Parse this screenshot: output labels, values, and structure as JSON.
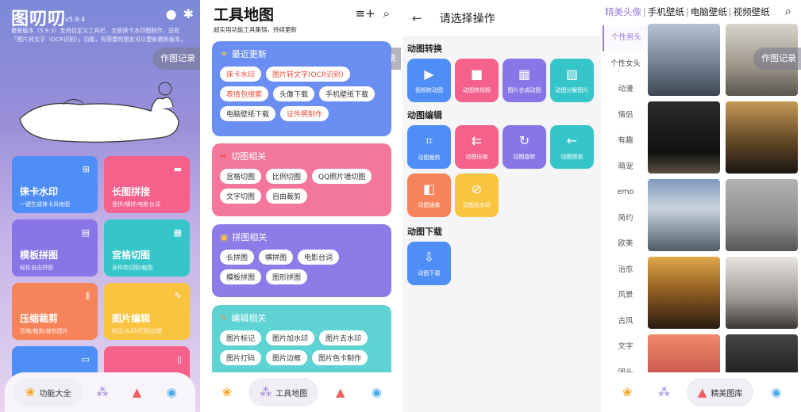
{
  "record_label": "作图记录",
  "panel1": {
    "app_title": "图叨叨",
    "version": "v5.9.4",
    "description": "最新版本（5.9.3）支持自定义工具栏，全新徕卡水印图制作，还有「图片转文字（OCR识别）」功能，有需要的朋友可以更新最新版本。",
    "tiles": [
      {
        "title": "徕卡水印",
        "sub": "一键生成徕卡风格图",
        "color": "#4f8ef7"
      },
      {
        "title": "长图拼接",
        "sub": "竖拼/横拼/电影台词",
        "color": "#f4618b"
      },
      {
        "title": "模板拼图",
        "sub": "轻松自由拼图",
        "color": "#8a75e6"
      },
      {
        "title": "宫格切图",
        "sub": "多种类切图/裁图",
        "color": "#36c6c9"
      },
      {
        "title": "压缩裁剪",
        "sub": "压缩/裁剪/裁剪图片",
        "color": "#f6835a"
      },
      {
        "title": "图片编辑",
        "sub": "标记/水印/打码/边框",
        "color": "#f9c440"
      },
      {
        "title": "",
        "sub": "",
        "color": "#4f8ef7"
      },
      {
        "title": "",
        "sub": "",
        "color": "#f4618b"
      }
    ],
    "dock_active": "功能大全"
  },
  "panel2": {
    "title": "工具地图",
    "subtitle": "超实用功能工具集锦，持续更新",
    "cards": [
      {
        "header": "最近更新",
        "icon": "☀",
        "color": "#6b8ef3",
        "chips": [
          {
            "label": "徕卡水印",
            "red": true
          },
          {
            "label": "图片转文字(OCR识别)",
            "red": true
          },
          {
            "label": "表情包搜索",
            "red": true
          },
          {
            "label": "头像下载",
            "red": false
          },
          {
            "label": "手机壁纸下载",
            "red": false
          },
          {
            "label": "电脑壁纸下载",
            "red": false
          },
          {
            "label": "证件照制作",
            "red": true
          }
        ]
      },
      {
        "header": "切图相关",
        "icon": "✂",
        "color": "#f2779b",
        "chips": [
          {
            "label": "宫格切图"
          },
          {
            "label": "比例切图"
          },
          {
            "label": "QQ照片墙切图"
          },
          {
            "label": "文字切图"
          },
          {
            "label": "自由裁剪"
          }
        ]
      },
      {
        "header": "拼图相关",
        "icon": "▣",
        "color": "#8d7ce8",
        "chips": [
          {
            "label": "长拼图"
          },
          {
            "label": "横拼图"
          },
          {
            "label": "电影台词"
          },
          {
            "label": "模板拼图"
          },
          {
            "label": "图形拼图"
          }
        ]
      },
      {
        "header": "编辑相关",
        "icon": "✎",
        "color": "#5fd3d3",
        "chips": [
          {
            "label": "图片标记"
          },
          {
            "label": "图片加水印"
          },
          {
            "label": "图片去水印"
          },
          {
            "label": "图片打码"
          },
          {
            "label": "图片边框"
          },
          {
            "label": "图片色卡制作"
          }
        ]
      }
    ],
    "dock_active": "工具地图"
  },
  "panel3": {
    "title": "请选择操作",
    "sections": [
      {
        "name": "动图转换",
        "items": [
          {
            "label": "视频转动图",
            "color": "#4f8ef7",
            "icon": "▶"
          },
          {
            "label": "动图转视频",
            "color": "#f4618b",
            "icon": "■"
          },
          {
            "label": "图片合成动图",
            "color": "#8a75e6",
            "icon": "▦"
          },
          {
            "label": "动图分解图片",
            "color": "#36c6c9",
            "icon": "▨"
          }
        ]
      },
      {
        "name": "动图编辑",
        "items": [
          {
            "label": "动图裁剪",
            "color": "#4f8ef7",
            "icon": "⌗"
          },
          {
            "label": "动图压缩",
            "color": "#f4618b",
            "icon": "⇇"
          },
          {
            "label": "动图旋转",
            "color": "#8a75e6",
            "icon": "↻"
          },
          {
            "label": "动图倒放",
            "color": "#36c6c9",
            "icon": "←"
          },
          {
            "label": "动图镜像",
            "color": "#f6835a",
            "icon": "◧"
          },
          {
            "label": "动图去水印",
            "color": "#f9c440",
            "icon": "⊘"
          }
        ]
      },
      {
        "name": "动图下载",
        "items": [
          {
            "label": "动图下载",
            "color": "#4f8ef7",
            "icon": "⇩"
          }
        ]
      }
    ]
  },
  "panel4": {
    "tabs": [
      "精美头像",
      "手机壁纸",
      "电脑壁纸",
      "视频壁纸"
    ],
    "side": [
      "个性男头",
      "个性女头",
      "动漫",
      "情侣",
      "有趣",
      "萌宠",
      "emo",
      "简约",
      "欧美",
      "治愈",
      "风景",
      "古风",
      "文字",
      "团头"
    ],
    "dock_active": "精美图库"
  }
}
